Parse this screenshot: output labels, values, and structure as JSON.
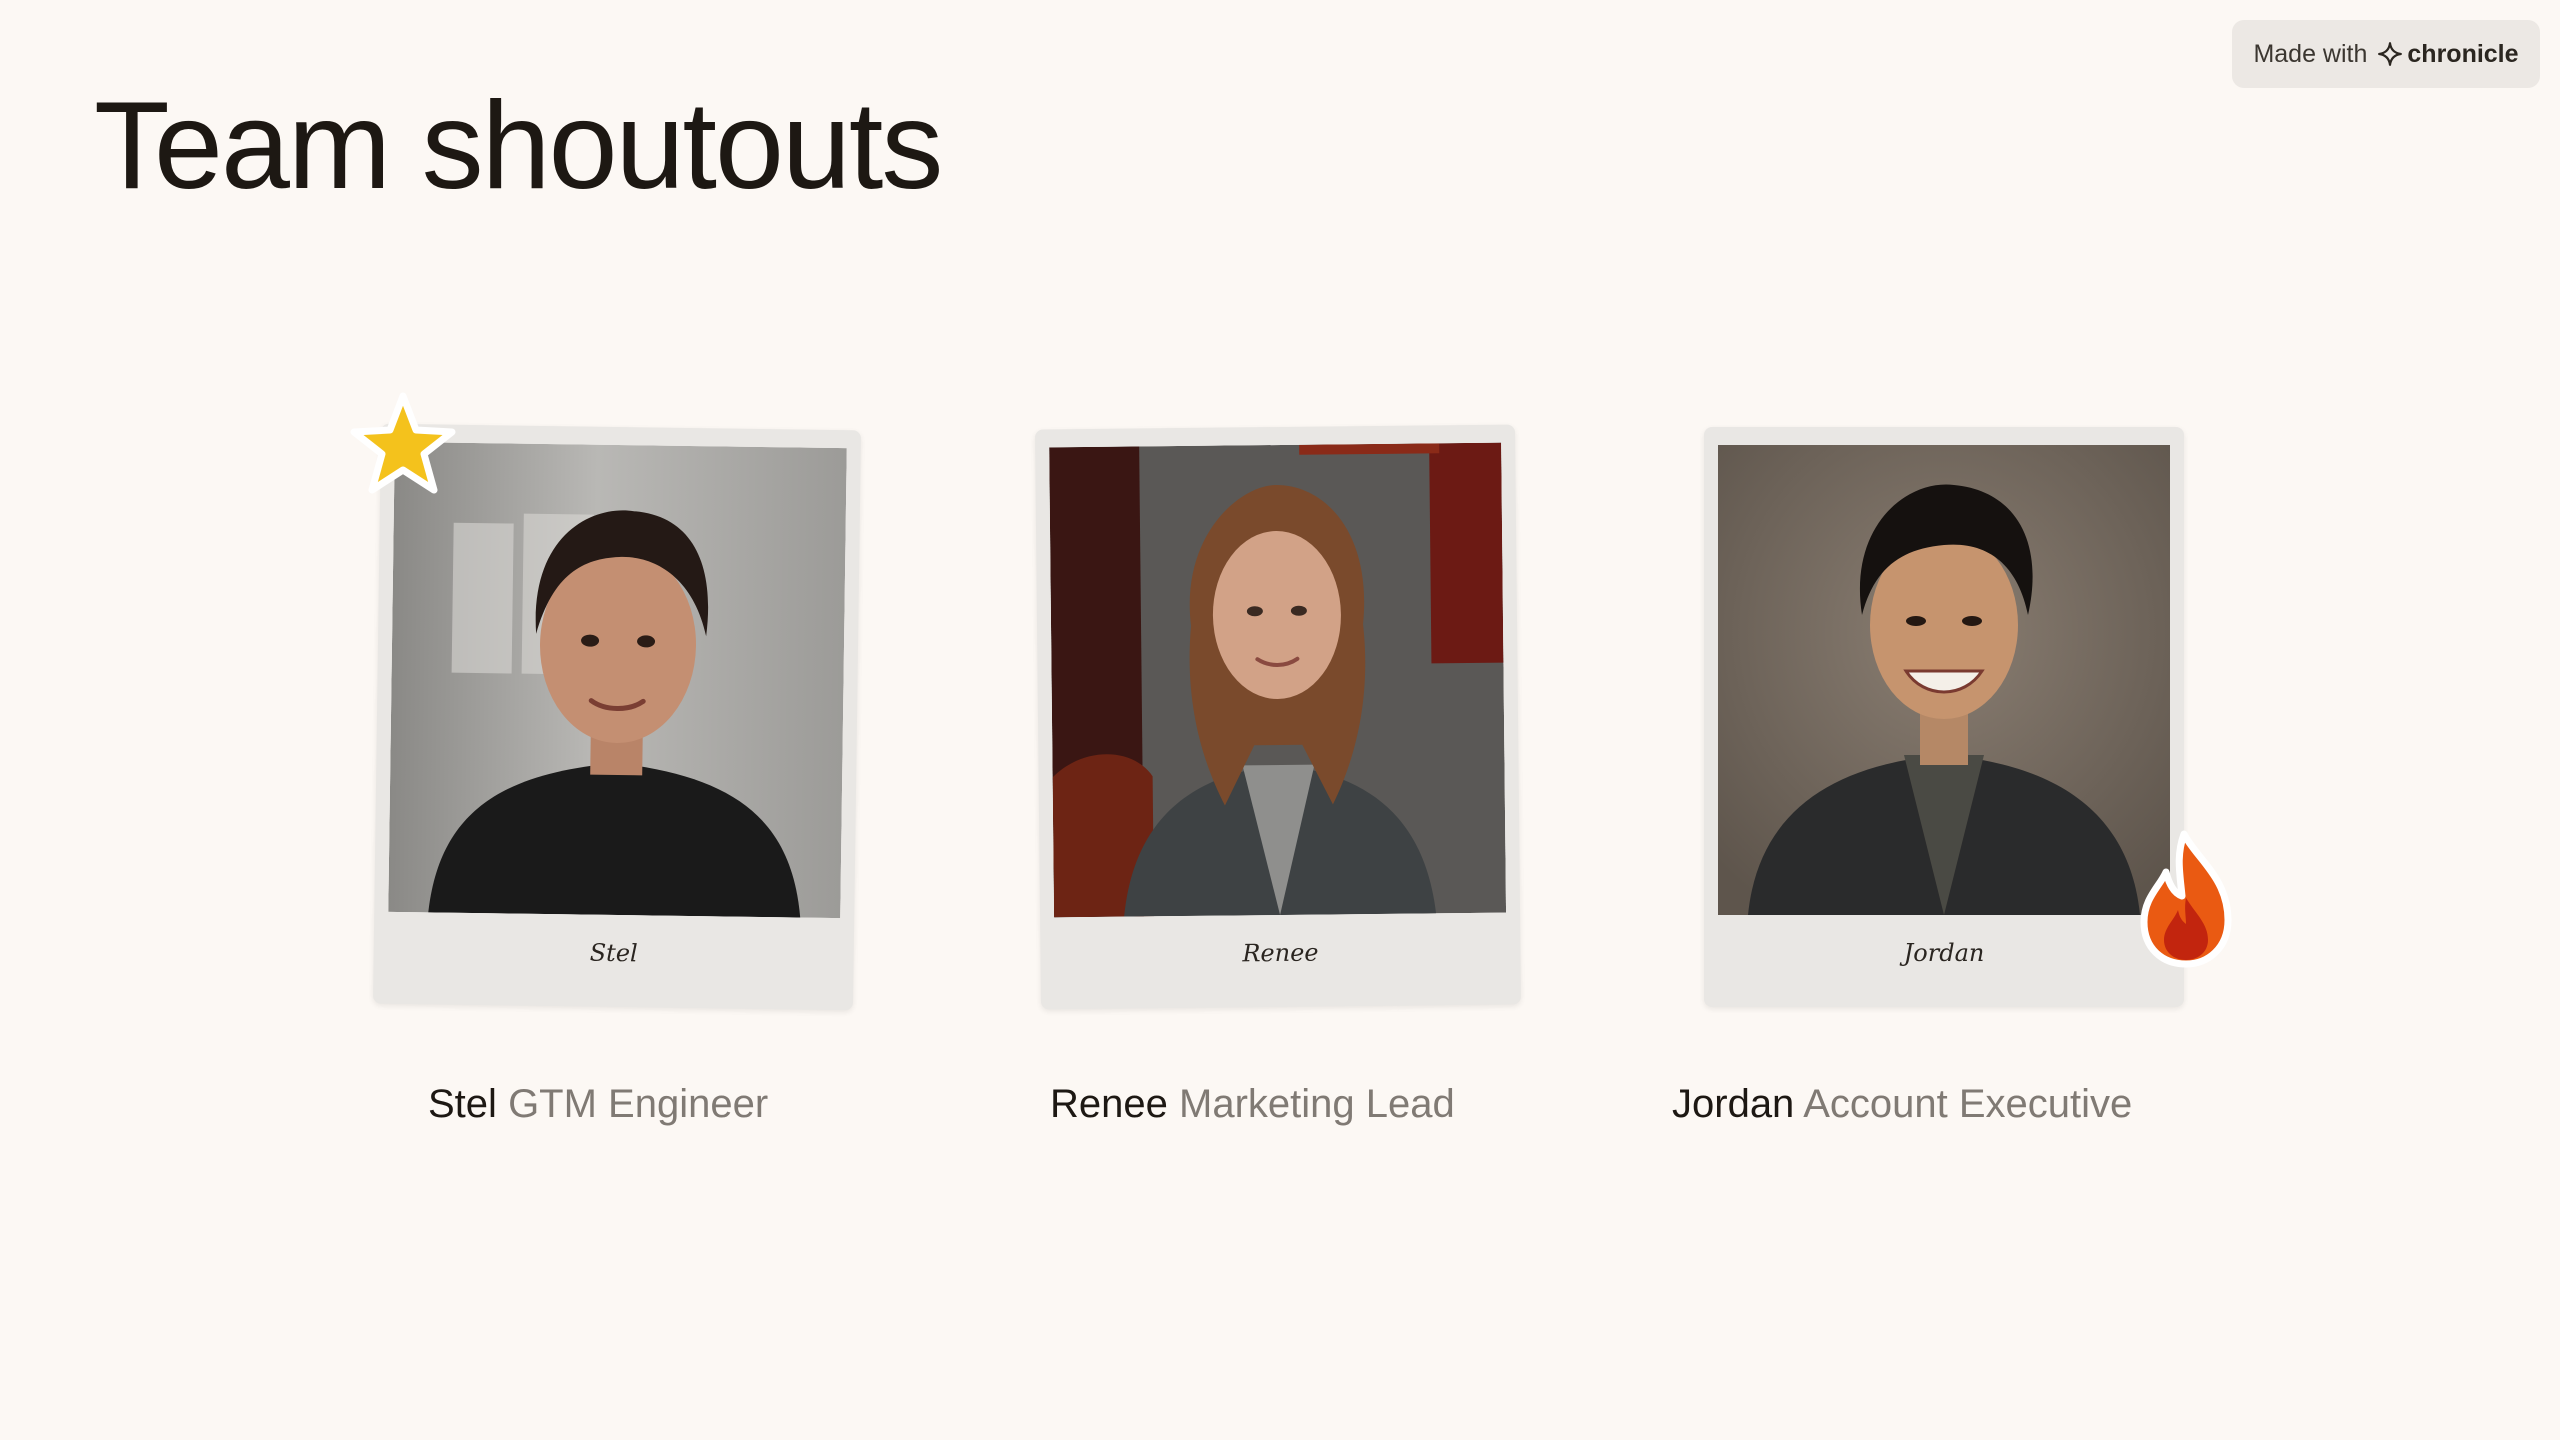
{
  "page": {
    "title": "Team shoutouts"
  },
  "badge": {
    "prefix": "Made with",
    "brand": "chronicle",
    "icon": "sparkle-icon"
  },
  "people": [
    {
      "name": "Stel",
      "role": "GTM Engineer",
      "caption": "Stel",
      "sticker": "star-icon"
    },
    {
      "name": "Renee",
      "role": "Marketing Lead",
      "caption": "Renee",
      "sticker": ""
    },
    {
      "name": "Jordan",
      "role": "Account Executive",
      "caption": "Jordan",
      "sticker": "fire-icon"
    }
  ],
  "colors": {
    "background": "#fcf8f4",
    "title": "#1d1813",
    "role_text": "#807a74",
    "polaroid": "#e9e7e4",
    "star": "#f4c21c",
    "fire": "#ea5a12"
  }
}
